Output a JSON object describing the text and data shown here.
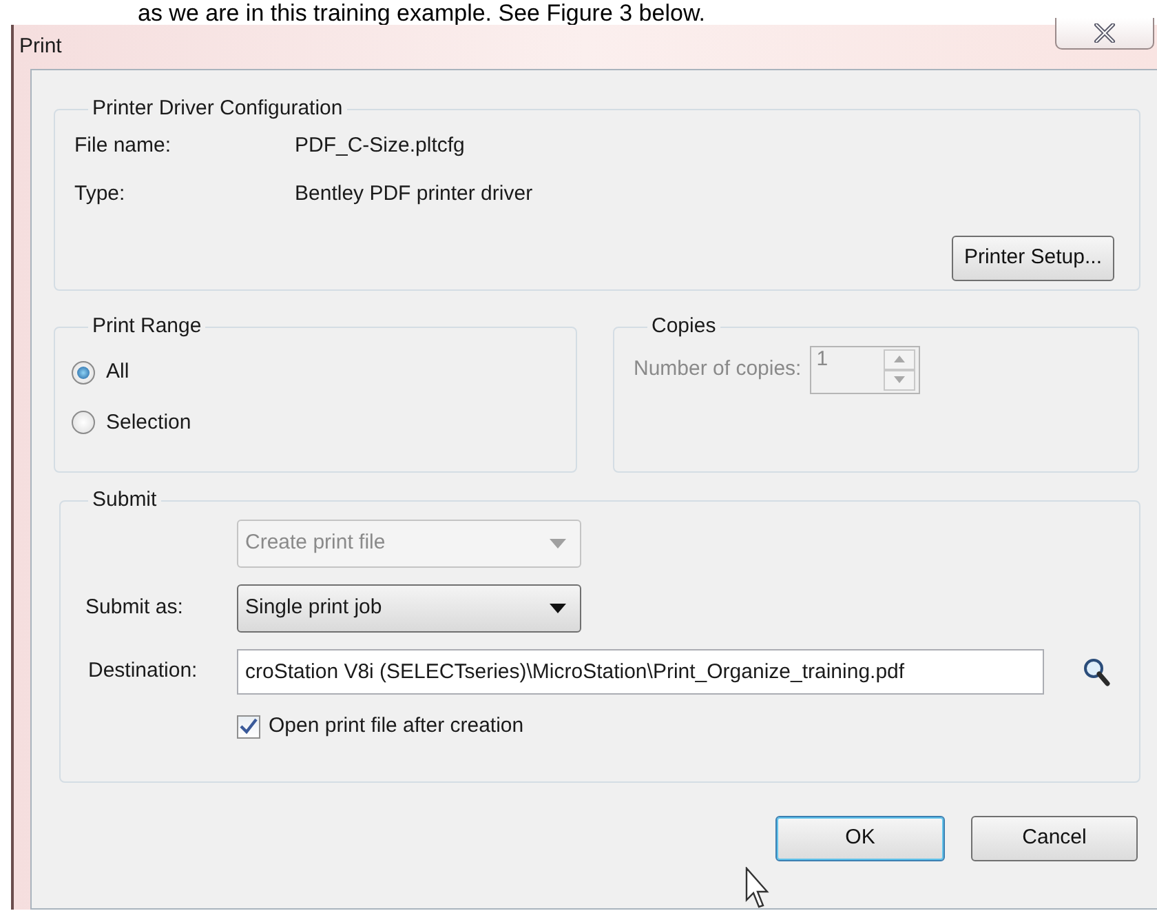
{
  "document_text": "as we are in this training example. See Figure 3 below.",
  "window": {
    "title": "Print"
  },
  "driver_config": {
    "title": "Printer Driver Configuration",
    "fields": [
      {
        "label": "File name:",
        "value": "PDF_C-Size.pltcfg"
      },
      {
        "label": "Type:",
        "value": "Bentley PDF printer driver"
      }
    ],
    "button": "Printer Setup..."
  },
  "print_range": {
    "title": "Print Range",
    "options": [
      {
        "label": "All",
        "selected": true
      },
      {
        "label": "Selection",
        "selected": false
      }
    ]
  },
  "copies": {
    "title": "Copies",
    "label": "Number of copies:",
    "value": "1",
    "disabled": true
  },
  "submit": {
    "title": "Submit",
    "mode": {
      "value": "Create print file",
      "disabled": true
    },
    "submit_as": {
      "label": "Submit as:",
      "value": "Single print job"
    },
    "destination": {
      "label": "Destination:",
      "value": "croStation V8i (SELECTseries)\\MicroStation\\Print_Organize_training.pdf"
    },
    "open_after": {
      "label": "Open print file after creation",
      "checked": true
    }
  },
  "buttons": [
    {
      "label": "OK",
      "default": true
    },
    {
      "label": "Cancel",
      "default": false
    }
  ]
}
